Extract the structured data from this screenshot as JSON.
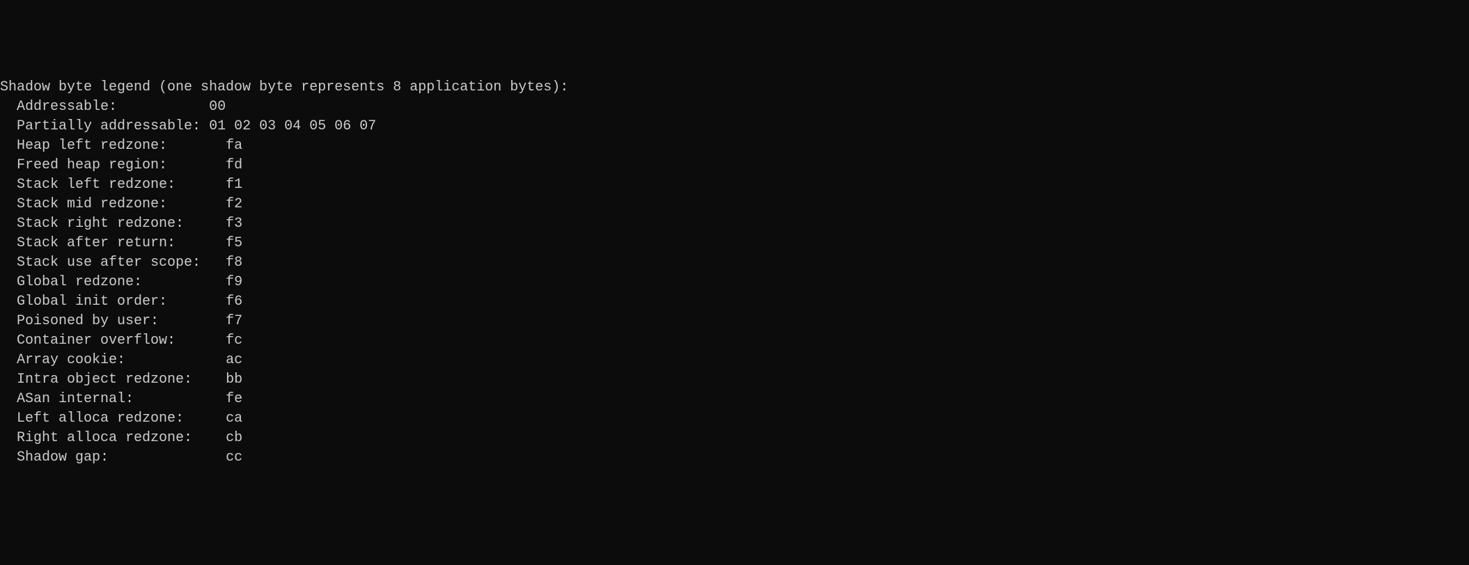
{
  "legend": {
    "header": "Shadow byte legend (one shadow byte represents 8 application bytes):",
    "entries": [
      {
        "label": "  Addressable:           ",
        "value": "00"
      },
      {
        "label": "  Partially addressable: ",
        "value": "01 02 03 04 05 06 07"
      },
      {
        "label": "  Heap left redzone:       ",
        "value": "fa"
      },
      {
        "label": "  Freed heap region:       ",
        "value": "fd"
      },
      {
        "label": "  Stack left redzone:      ",
        "value": "f1"
      },
      {
        "label": "  Stack mid redzone:       ",
        "value": "f2"
      },
      {
        "label": "  Stack right redzone:     ",
        "value": "f3"
      },
      {
        "label": "  Stack after return:      ",
        "value": "f5"
      },
      {
        "label": "  Stack use after scope:   ",
        "value": "f8"
      },
      {
        "label": "  Global redzone:          ",
        "value": "f9"
      },
      {
        "label": "  Global init order:       ",
        "value": "f6"
      },
      {
        "label": "  Poisoned by user:        ",
        "value": "f7"
      },
      {
        "label": "  Container overflow:      ",
        "value": "fc"
      },
      {
        "label": "  Array cookie:            ",
        "value": "ac"
      },
      {
        "label": "  Intra object redzone:    ",
        "value": "bb"
      },
      {
        "label": "  ASan internal:           ",
        "value": "fe"
      },
      {
        "label": "  Left alloca redzone:     ",
        "value": "ca"
      },
      {
        "label": "  Right alloca redzone:    ",
        "value": "cb"
      },
      {
        "label": "  Shadow gap:              ",
        "value": "cc"
      }
    ]
  }
}
